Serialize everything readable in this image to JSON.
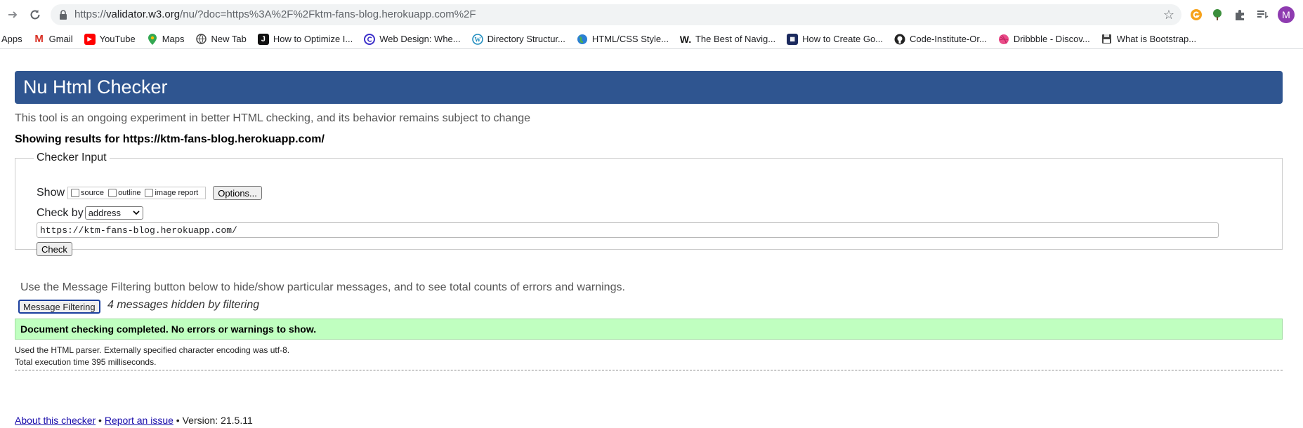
{
  "browser": {
    "url_host": "validator.w3.org",
    "url_rest": "/nu/?doc=https%3A%2F%2Fktm-fans-blog.herokuapp.com%2F",
    "url_prefix": "https://",
    "profile_initial": "M",
    "bookmarks": [
      {
        "label": "Apps",
        "icon": "apps-icon"
      },
      {
        "label": "Gmail",
        "icon": "gmail-icon"
      },
      {
        "label": "YouTube",
        "icon": "youtube-icon"
      },
      {
        "label": "Maps",
        "icon": "maps-icon"
      },
      {
        "label": "New Tab",
        "icon": "globe-icon"
      },
      {
        "label": "How to Optimize I...",
        "icon": "j-icon"
      },
      {
        "label": "Web Design: Whe...",
        "icon": "c-circle-icon"
      },
      {
        "label": "Directory Structur...",
        "icon": "wordpress-icon"
      },
      {
        "label": "HTML/CSS Style...",
        "icon": "earth-icon"
      },
      {
        "label": "The Best of Navig...",
        "icon": "w-icon"
      },
      {
        "label": "How to Create Go...",
        "icon": "site-icon"
      },
      {
        "label": "Code-Institute-Or...",
        "icon": "github-icon"
      },
      {
        "label": "Dribbble - Discov...",
        "icon": "dribbble-icon"
      },
      {
        "label": "What is Bootstrap...",
        "icon": "floppy-icon"
      }
    ]
  },
  "page": {
    "title": "Nu Html Checker",
    "intro": "This tool is an ongoing experiment in better HTML checking, and its behavior remains subject to change",
    "showing": "Showing results for https://ktm-fans-blog.herokuapp.com/",
    "checker_legend": "Checker Input",
    "show_label": "Show",
    "opt_source": "source",
    "opt_outline": "outline",
    "opt_image_report": "image report",
    "options_button": "Options...",
    "check_by_label": "Check by",
    "check_by_value": "address",
    "address_value": "https://ktm-fans-blog.herokuapp.com/",
    "check_button": "Check",
    "filter_note": "Use the Message Filtering button below to hide/show particular messages, and to see total counts of errors and warnings.",
    "filter_button": "Message Filtering",
    "hidden_count": "4 messages hidden by filtering",
    "success": "Document checking completed. No errors or warnings to show.",
    "details_parser": "Used the HTML parser. Externally specified character encoding was utf-8.",
    "details_time": "Total execution time 395 milliseconds.",
    "footer_about": "About this checker",
    "footer_sep1": " • ",
    "footer_report": "Report an issue",
    "footer_version": " • Version: 21.5.11"
  }
}
